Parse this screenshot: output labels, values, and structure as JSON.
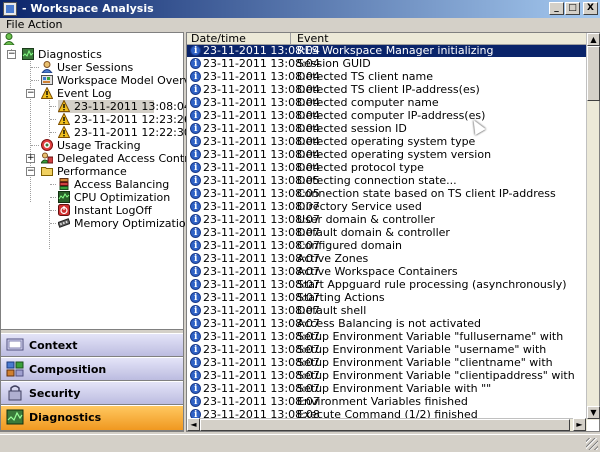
{
  "window": {
    "title": "- Workspace Analysis",
    "min_label": "_",
    "max_label": "□",
    "close_label": "X"
  },
  "menu": {
    "file": "File",
    "action": "Action"
  },
  "tree": {
    "root": "Diagnostics",
    "user_sessions": "User Sessions",
    "workspace_model": "Workspace Model Overview",
    "event_log": "Event Log",
    "log_entries": [
      "23-11-2011 13:08:04",
      "23-11-2011 12:23:26",
      "23-11-2011 12:22:30"
    ],
    "usage_tracking": "Usage Tracking",
    "delegated_access": "Delegated Access Control",
    "performance": "Performance",
    "perf_items": [
      "Access Balancing",
      "CPU Optimization",
      "Instant LogOff",
      "Memory Optimization"
    ]
  },
  "nav": {
    "context": "Context",
    "composition": "Composition",
    "security": "Security",
    "diagnostics": "Diagnostics"
  },
  "table": {
    "col_datetime": "Date/time",
    "col_event": "Event",
    "rows": [
      {
        "dt": "23-11-2011 13:08:04",
        "ev": "RES Workspace Manager initializing"
      },
      {
        "dt": "23-11-2011 13:08:04",
        "ev": "Session GUID"
      },
      {
        "dt": "23-11-2011 13:08:04",
        "ev": "Detected TS client name"
      },
      {
        "dt": "23-11-2011 13:08:04",
        "ev": "Detected TS client IP-address(es)"
      },
      {
        "dt": "23-11-2011 13:08:04",
        "ev": "Detected computer name"
      },
      {
        "dt": "23-11-2011 13:08:04",
        "ev": "Detected computer IP-address(es)"
      },
      {
        "dt": "23-11-2011 13:08:04",
        "ev": "Detected session ID"
      },
      {
        "dt": "23-11-2011 13:08:04",
        "ev": "Detected operating system type"
      },
      {
        "dt": "23-11-2011 13:08:04",
        "ev": "Detected operating system version"
      },
      {
        "dt": "23-11-2011 13:08:04",
        "ev": "Detected protocol type"
      },
      {
        "dt": "23-11-2011 13:08:05",
        "ev": "Detecting connection state..."
      },
      {
        "dt": "23-11-2011 13:08:05",
        "ev": "Connection state based on TS client IP-address"
      },
      {
        "dt": "23-11-2011 13:08:07",
        "ev": "Directory Service used"
      },
      {
        "dt": "23-11-2011 13:08:07",
        "ev": "User domain & controller"
      },
      {
        "dt": "23-11-2011 13:08:07",
        "ev": "Default domain & controller"
      },
      {
        "dt": "23-11-2011 13:08:07",
        "ev": "Configured domain"
      },
      {
        "dt": "23-11-2011 13:08:07",
        "ev": "Active Zones"
      },
      {
        "dt": "23-11-2011 13:08:07",
        "ev": "Active Workspace Containers"
      },
      {
        "dt": "23-11-2011 13:08:07",
        "ev": "Start Appguard rule processing (asynchronously)"
      },
      {
        "dt": "23-11-2011 13:08:07",
        "ev": "Starting Actions"
      },
      {
        "dt": "23-11-2011 13:08:07",
        "ev": "Default shell"
      },
      {
        "dt": "23-11-2011 13:08:07",
        "ev": "Access Balancing is not activated"
      },
      {
        "dt": "23-11-2011 13:08:07",
        "ev": "Setup Environment Variable \"fullusername\" with"
      },
      {
        "dt": "23-11-2011 13:08:07",
        "ev": "Setup Environment Variable \"username\" with"
      },
      {
        "dt": "23-11-2011 13:08:07",
        "ev": "Setup Environment Variable \"clientname\" with"
      },
      {
        "dt": "23-11-2011 13:08:07",
        "ev": "Setup Environment Variable \"clientipaddress\" with"
      },
      {
        "dt": "23-11-2011 13:08:07",
        "ev": "Setup Environment Variable          with \"\""
      },
      {
        "dt": "23-11-2011 13:08:07",
        "ev": "Environment Variables finished"
      },
      {
        "dt": "23-11-2011 13:08:08",
        "ev": "Execute Command (1/2) finished"
      }
    ]
  },
  "colors": {
    "selection": "#0a246a",
    "nav_active": "#f5a623",
    "nav_inactive": "#c8c8e8"
  }
}
